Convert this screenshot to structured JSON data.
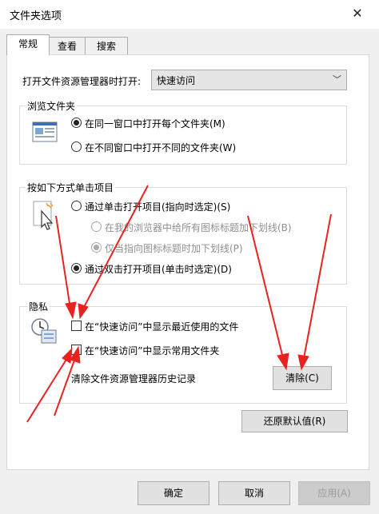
{
  "window": {
    "title": "文件夹选项",
    "close_glyph": "✕"
  },
  "tabs": [
    {
      "label": "常规",
      "active": true
    },
    {
      "label": "查看",
      "active": false
    },
    {
      "label": "搜索",
      "active": false
    }
  ],
  "open_explorer": {
    "label": "打开文件资源管理器时打开:",
    "value": "快速访问"
  },
  "browse_folders": {
    "title": "浏览文件夹",
    "options": [
      {
        "label": "在同一窗口中打开每个文件夹(M)",
        "checked": true
      },
      {
        "label": "在不同窗口中打开不同的文件夹(W)",
        "checked": false
      }
    ]
  },
  "click_items": {
    "title": "按如下方式单击项目",
    "single_click": {
      "label": "通过单击打开项目(指向时选定)(S)",
      "checked": false
    },
    "underline_all": {
      "label": "在我的浏览器中给所有图标标题加下划线(B)",
      "checked": false,
      "disabled": true
    },
    "underline_point": {
      "label": "仅当指向图标标题时加下划线(P)",
      "checked": true,
      "disabled": true
    },
    "double_click": {
      "label": "通过双击打开项目(单击时选定)(D)",
      "checked": true
    }
  },
  "privacy": {
    "title": "隐私",
    "recent_files": {
      "label": "在“快速访问”中显示最近使用的文件",
      "checked": false
    },
    "frequent_folders": {
      "label": "在“快速访问”中显示常用文件夹",
      "checked": false
    },
    "clear_history_label": "清除文件资源管理器历史记录",
    "clear_button": "清除(C)"
  },
  "restore_button": "还原默认值(R)",
  "footer": {
    "ok": "确定",
    "cancel": "取消",
    "apply": "应用(A)"
  },
  "colors": {
    "annotation_arrow": "#e8231f",
    "panel": "#ffffff",
    "dialog": "#f0f0f0"
  }
}
